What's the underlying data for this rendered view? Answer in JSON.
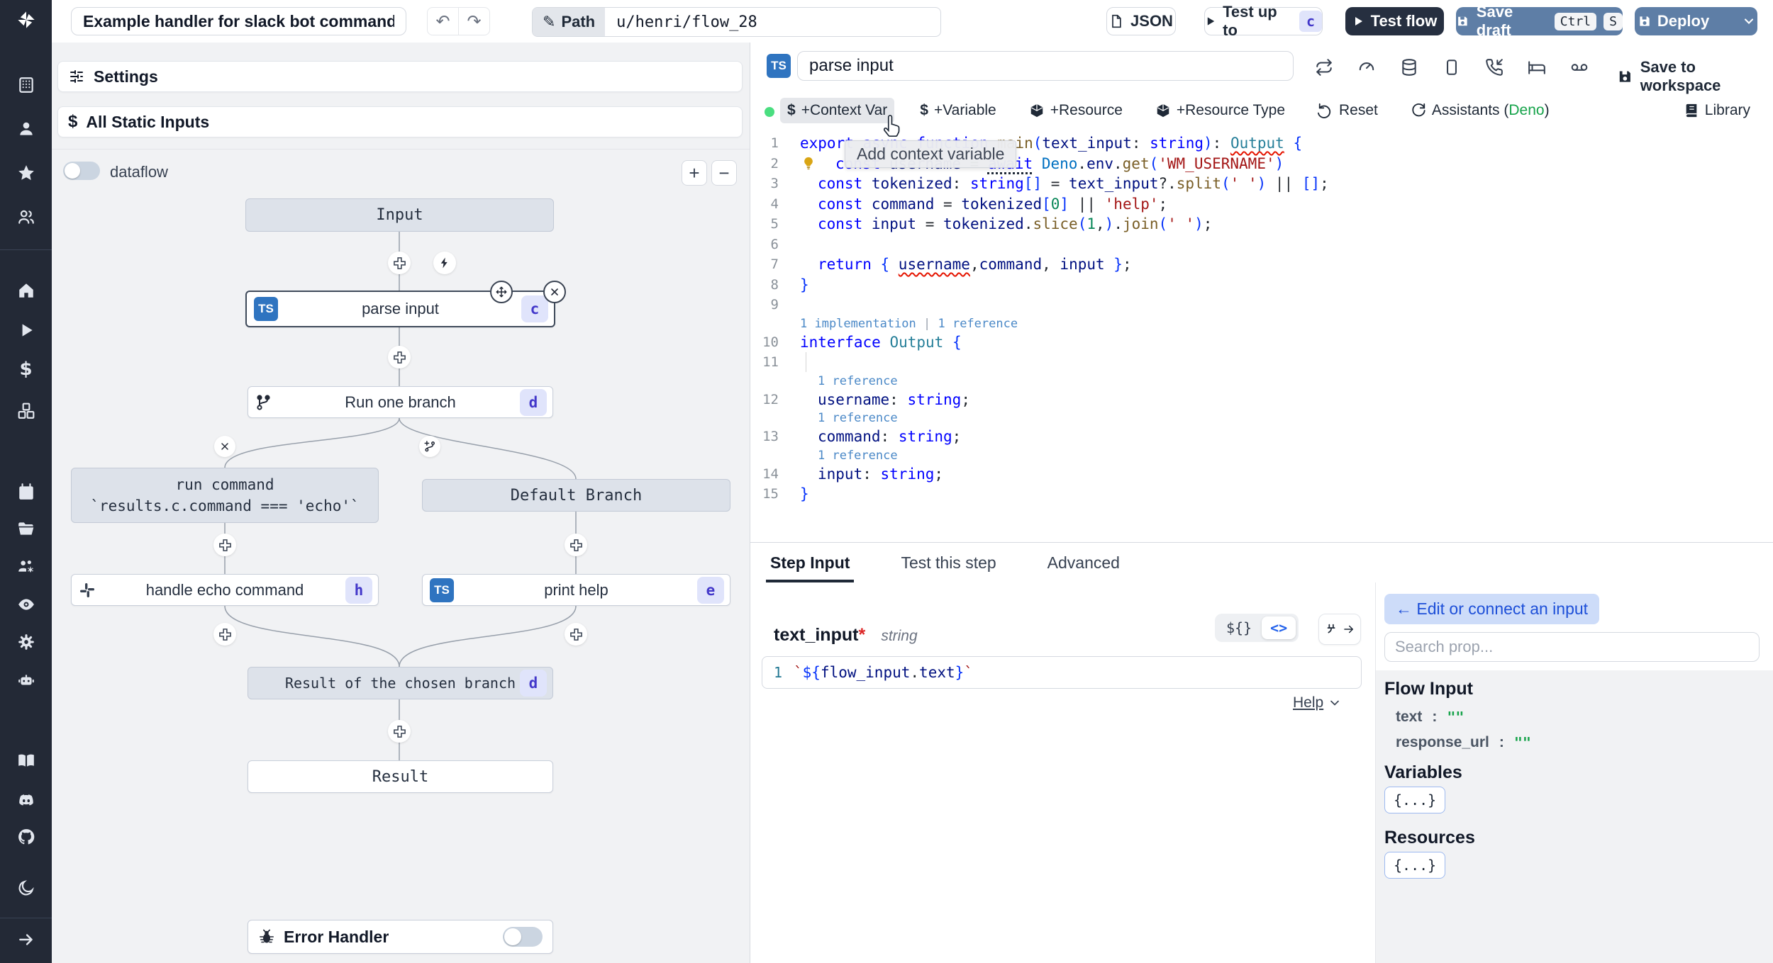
{
  "topbar": {
    "title": "Example handler for slack bot commands",
    "path_label": "Path",
    "path_value": "u/henri/flow_28",
    "json_label": "JSON",
    "test_up_to": "Test up to",
    "test_up_to_badge": "c",
    "test_flow": "Test flow",
    "save_draft": "Save draft",
    "kbd": [
      "Ctrl",
      "S"
    ],
    "deploy": "Deploy"
  },
  "sidebar": {
    "icons": [
      "windmill-logo",
      "building",
      "user",
      "star",
      "users",
      "home",
      "play",
      "dollar",
      "boxes",
      "calendar",
      "folder-open",
      "user-cog",
      "eye",
      "gear",
      "robot",
      "book",
      "discord",
      "github",
      "moon",
      "arrow-right"
    ]
  },
  "flow": {
    "settings_label": "Settings",
    "static_inputs_label": "All Static Inputs",
    "dataflow_label": "dataflow",
    "zoom_in": "+",
    "zoom_out": "−",
    "nodes": {
      "input": "Input",
      "parse": {
        "label": "parse input",
        "badge": "c",
        "lang": "TS"
      },
      "branch_all": {
        "label": "Run one branch",
        "badge": "d"
      },
      "run_command": {
        "line1": "run command",
        "line2": "`results.c.command === 'echo'`"
      },
      "default_branch": "Default Branch",
      "handle_echo": {
        "label": "handle echo command",
        "badge": "h"
      },
      "print_help": {
        "label": "print help",
        "badge": "e",
        "lang": "TS"
      },
      "result_chosen": {
        "label": "Result of the chosen branch",
        "badge": "d"
      },
      "result": "Result"
    },
    "error_handler_label": "Error Handler"
  },
  "editor": {
    "lang_badge": "TS",
    "step_name": "parse input",
    "save_to_workspace": "Save to workspace",
    "toolbar": {
      "context_var": "+Context Var",
      "variable": "+Variable",
      "resource": "+Resource",
      "resource_type": "+Resource Type",
      "reset": "Reset",
      "assistants_prefix": "Assistants (",
      "assistants_runtime": "Deno",
      "assistants_suffix": ")",
      "library": "Library"
    },
    "tooltip": "Add context variable",
    "code": {
      "rows": [
        {
          "n": "1",
          "t": [
            [
              "export ",
              "kw"
            ],
            [
              "async ",
              "kw"
            ],
            [
              "function ",
              "kw"
            ],
            [
              "main",
              "fn"
            ],
            [
              "(",
              "bk"
            ],
            [
              "text_input",
              "vr"
            ],
            [
              ": ",
              "pn"
            ],
            [
              "string",
              "kw"
            ],
            [
              ")",
              "bk"
            ],
            [
              ": ",
              "pn"
            ],
            [
              "Output",
              "cls err"
            ],
            [
              " {",
              "bk"
            ]
          ]
        },
        {
          "n": "2",
          "bulb": true,
          "ind": 1,
          "t": [
            [
              "const ",
              "kw"
            ],
            [
              "username",
              "vr"
            ],
            [
              " = ",
              "pn"
            ],
            [
              "await",
              "kw sug"
            ],
            [
              " ",
              "pn"
            ],
            [
              "Deno",
              "deno"
            ],
            [
              ".",
              "pn"
            ],
            [
              "env",
              "vr"
            ],
            [
              ".",
              "pn"
            ],
            [
              "get",
              "fn"
            ],
            [
              "(",
              "bk"
            ],
            [
              "'WM_USERNAME'",
              "str"
            ],
            [
              ")",
              "bk"
            ]
          ]
        },
        {
          "n": "3",
          "ind": 1,
          "t": [
            [
              "const ",
              "kw"
            ],
            [
              "tokenized",
              "vr"
            ],
            [
              ": ",
              "pn"
            ],
            [
              "string",
              "kw"
            ],
            [
              "[]",
              "bk"
            ],
            [
              " = ",
              "pn"
            ],
            [
              "text_input",
              "vr"
            ],
            [
              "?.",
              "pn"
            ],
            [
              "split",
              "fn"
            ],
            [
              "(",
              "bk"
            ],
            [
              "' '",
              "str"
            ],
            [
              ")",
              "bk"
            ],
            [
              " || ",
              "pn"
            ],
            [
              "[]",
              "bk"
            ],
            [
              ";",
              "pn"
            ]
          ]
        },
        {
          "n": "4",
          "ind": 1,
          "t": [
            [
              "const ",
              "kw"
            ],
            [
              "command",
              "vr"
            ],
            [
              " = ",
              "pn"
            ],
            [
              "tokenized",
              "vr"
            ],
            [
              "[",
              "bk"
            ],
            [
              "0",
              "num"
            ],
            [
              "]",
              "bk"
            ],
            [
              " || ",
              "pn"
            ],
            [
              "'help'",
              "str"
            ],
            [
              ";",
              "pn"
            ]
          ]
        },
        {
          "n": "5",
          "ind": 1,
          "t": [
            [
              "const ",
              "kw"
            ],
            [
              "input",
              "vr"
            ],
            [
              " = ",
              "pn"
            ],
            [
              "tokenized",
              "vr"
            ],
            [
              ".",
              "pn"
            ],
            [
              "slice",
              "fn"
            ],
            [
              "(",
              "bk"
            ],
            [
              "1",
              "num"
            ],
            [
              ",",
              "pn"
            ],
            [
              ")",
              "bk"
            ],
            [
              ".",
              "pn"
            ],
            [
              "join",
              "fn"
            ],
            [
              "(",
              "bk"
            ],
            [
              "' '",
              "str"
            ],
            [
              ")",
              "bk"
            ],
            [
              ";",
              "pn"
            ]
          ]
        },
        {
          "n": "6",
          "t": []
        },
        {
          "n": "7",
          "ind": 1,
          "t": [
            [
              "return",
              "kw"
            ],
            [
              " { ",
              "bk"
            ],
            [
              "username",
              "vr err"
            ],
            [
              ",",
              "pn"
            ],
            [
              "command",
              "vr"
            ],
            [
              ", ",
              "pn"
            ],
            [
              "input",
              "vr"
            ],
            [
              " }",
              "bk"
            ],
            [
              ";",
              "pn"
            ]
          ]
        },
        {
          "n": "8",
          "t": [
            [
              "}",
              "bk"
            ]
          ]
        },
        {
          "n": "9",
          "t": []
        },
        {
          "lens": [
            "1 implementation",
            "1 reference"
          ],
          "ind": 0
        },
        {
          "n": "10",
          "t": [
            [
              "interface ",
              "kw"
            ],
            [
              "Output",
              "cls"
            ],
            [
              " {",
              "bk"
            ]
          ]
        },
        {
          "n": "11",
          "guide": true,
          "t": []
        },
        {
          "lens": [
            "1 reference"
          ],
          "ind": 1
        },
        {
          "n": "12",
          "ind": 1,
          "t": [
            [
              "username",
              "vr"
            ],
            [
              ": ",
              "pn"
            ],
            [
              "string",
              "kw"
            ],
            [
              ";",
              "pn"
            ]
          ]
        },
        {
          "lens": [
            "1 reference"
          ],
          "ind": 1
        },
        {
          "n": "13",
          "ind": 1,
          "t": [
            [
              "command",
              "vr"
            ],
            [
              ": ",
              "pn"
            ],
            [
              "string",
              "kw"
            ],
            [
              ";",
              "pn"
            ]
          ]
        },
        {
          "lens": [
            "1 reference"
          ],
          "ind": 1
        },
        {
          "n": "14",
          "ind": 1,
          "t": [
            [
              "input",
              "vr"
            ],
            [
              ": ",
              "pn"
            ],
            [
              "string",
              "kw"
            ],
            [
              ";",
              "pn"
            ]
          ]
        },
        {
          "n": "15",
          "t": [
            [
              "}",
              "bk"
            ]
          ]
        }
      ]
    }
  },
  "tabs": {
    "step_input": "Step Input",
    "test_step": "Test this step",
    "advanced": "Advanced"
  },
  "step_input": {
    "field": "text_input",
    "required_mark": "*",
    "type": "string",
    "expr_toggle": "${}",
    "code_toggle": "<>",
    "gutter": "1",
    "expr": [
      [
        "`",
        "str"
      ],
      [
        "${",
        "bk"
      ],
      [
        "flow_input",
        "vr"
      ],
      [
        ".",
        "pn"
      ],
      [
        "text",
        "vr"
      ],
      [
        "}",
        "bk"
      ],
      [
        "`",
        "str"
      ]
    ],
    "help": "Help"
  },
  "connect": {
    "back_button": "← Edit or connect an input",
    "search_placeholder": "Search prop...",
    "flow_input_title": "Flow Input",
    "props": [
      {
        "name": "text",
        "colon": ":",
        "value": "\"\""
      },
      {
        "name": "response_url",
        "colon": ":",
        "value": "\"\""
      }
    ],
    "variables_title": "Variables",
    "resources_title": "Resources",
    "object_chip": "{...}"
  }
}
